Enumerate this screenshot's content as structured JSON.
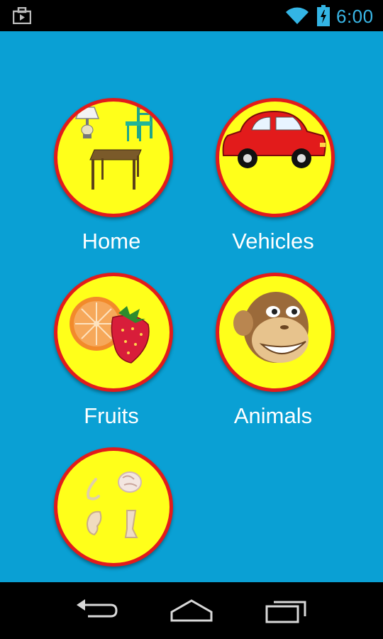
{
  "status_bar": {
    "time": "6:00",
    "icons": [
      "notification-briefcase-icon",
      "wifi-icon",
      "battery-icon"
    ],
    "accent_color": "#33b5e5"
  },
  "background_color": "#0aa0d4",
  "categories": [
    {
      "label": "Home",
      "icon": "furniture-icon"
    },
    {
      "label": "Vehicles",
      "icon": "car-icon"
    },
    {
      "label": "Fruits",
      "icon": "fruits-icon"
    },
    {
      "label": "Animals",
      "icon": "monkey-icon"
    },
    {
      "label": "",
      "icon": "body-parts-icon"
    }
  ],
  "tile_colors": {
    "fill": "#ffff1a",
    "border": "#e21b1b"
  },
  "nav_bar": {
    "buttons": [
      "back-icon",
      "home-icon",
      "recent-apps-icon"
    ]
  }
}
